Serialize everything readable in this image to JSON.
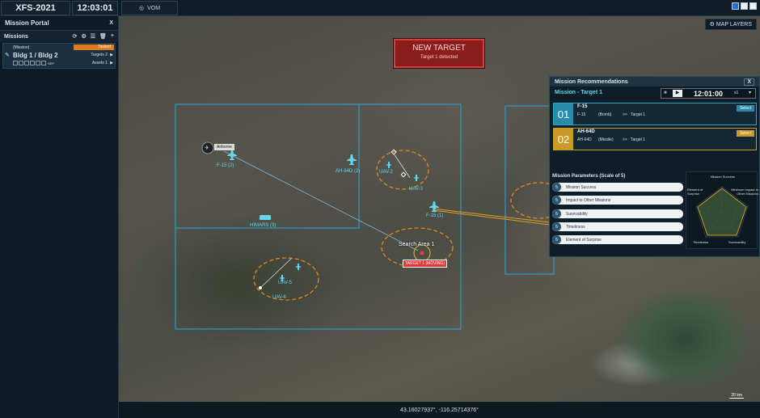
{
  "topbar": {
    "app_title": "XFS-2021",
    "clock": "12:03:01",
    "vom_label": "VOM"
  },
  "sidebar": {
    "title": "Mission Portal",
    "close": "X",
    "missions_label": "Missions",
    "mission": {
      "tag": "(Mission)",
      "status": "Tasked",
      "name": "Bldg 1 / Bldg 2",
      "targets": "Targets 2",
      "assets": "Assets 1",
      "sep": "SEP"
    }
  },
  "map": {
    "layers_label": "MAP LAYERS",
    "alert": {
      "title": "NEW TARGET",
      "subtitle": "Target 1 detected"
    },
    "labels": {
      "airborne": "Airborne",
      "f15_2": "F-15 (2)",
      "f15_1": "F-15 (1)",
      "ah64d": "AH-64D (2)",
      "uav2": "UAV-2",
      "uav3": "UAV-3",
      "himars": "HIMARS (3)",
      "search_area": "Search Area 1",
      "target": "TARGET 1 (MOVING)",
      "uav5": "UAV-5",
      "uav6": "UAV-6"
    },
    "coordinates": "43.16027937°, -116.25714376°",
    "scale": "20 km"
  },
  "panel": {
    "title": "Mission Recommendations",
    "close": "X",
    "subtitle": "Mission - Target 1",
    "time": "12:01:00",
    "speed": "x1",
    "recs": [
      {
        "num": "01",
        "aircraft": "F-15",
        "line_a": "F-15",
        "munition": "(Bomb)",
        "arrow": ">>",
        "target": "Target 1",
        "select": "Select",
        "color": "#2aa7c9"
      },
      {
        "num": "02",
        "aircraft": "AH-64D",
        "line_a": "AH-64D",
        "munition": "(Missile)",
        "arrow": ">>",
        "target": "Target 1",
        "select": "Select",
        "color": "#c99a2a"
      }
    ],
    "params_title": "Mission Parameters (Scale of 5)",
    "params": [
      {
        "s": "5",
        "label": "Mission Success"
      },
      {
        "s": "5",
        "label": "Impact to Other Missions"
      },
      {
        "s": "5",
        "label": "Survivability"
      },
      {
        "s": "5",
        "label": "Timeliness"
      },
      {
        "s": "5",
        "label": "Element of Surprise"
      }
    ],
    "radar": {
      "top": "Mission Success",
      "right": "Minimum Impact to Other Missions",
      "bottom_right": "Survivability",
      "bottom_left": "Timeliness",
      "left": "Element of Surprise"
    }
  }
}
